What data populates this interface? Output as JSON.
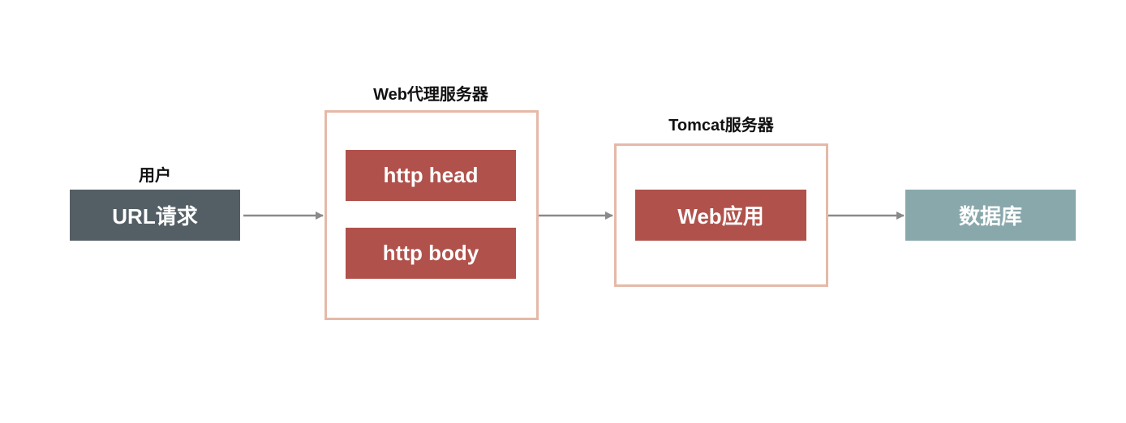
{
  "user": {
    "label": "用户",
    "box_text": "URL请求"
  },
  "proxy": {
    "label": "Web代理服务器",
    "items": [
      "http head",
      "http body"
    ]
  },
  "tomcat": {
    "label": "Tomcat服务器",
    "app_text": "Web应用"
  },
  "database": {
    "box_text": "数据库"
  },
  "colors": {
    "user_box": "#535f65",
    "proxy_item": "#b0514b",
    "app_box": "#b0514b",
    "database_box": "#89a8ac",
    "frame_border": "#e5b9a8",
    "arrow": "#8a8a8a"
  }
}
